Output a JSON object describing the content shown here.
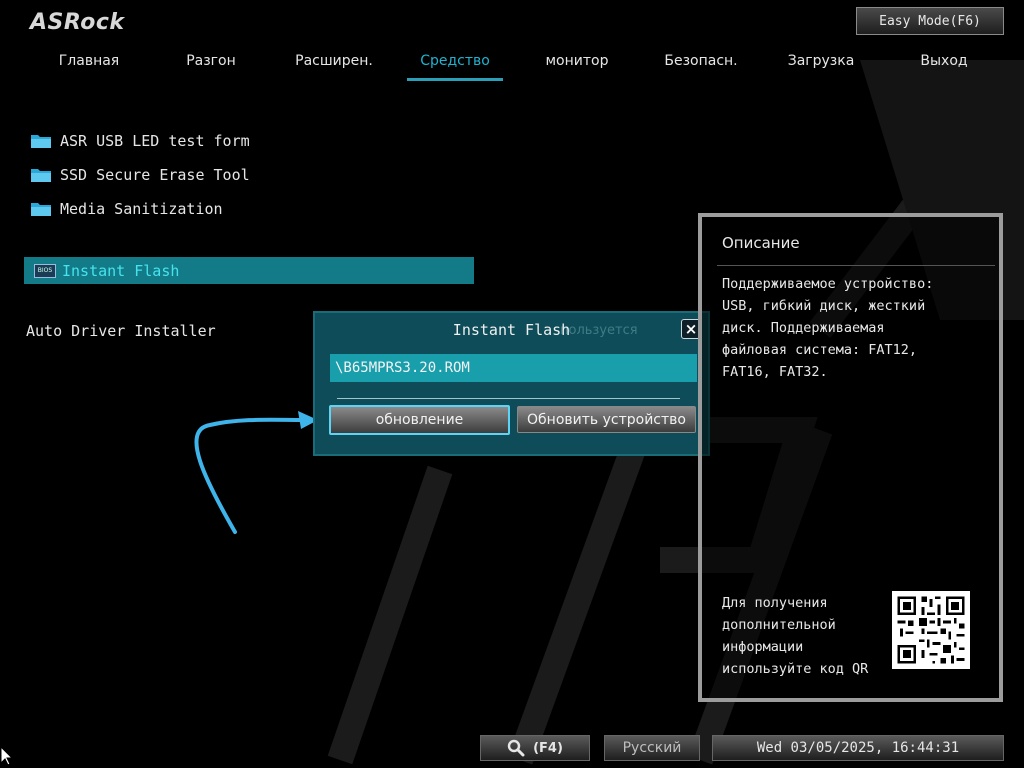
{
  "header": {
    "logo": "ASRock",
    "easy_mode": "Easy Mode(F6)"
  },
  "nav": {
    "tabs": [
      {
        "label": "Главная",
        "active": false
      },
      {
        "label": "Разгон",
        "active": false
      },
      {
        "label": "Расширен.",
        "active": false
      },
      {
        "label": "Средство",
        "active": true
      },
      {
        "label": "монитор",
        "active": false
      },
      {
        "label": "Безопасн.",
        "active": false
      },
      {
        "label": "Загрузка",
        "active": false
      },
      {
        "label": "Выход",
        "active": false
      }
    ]
  },
  "tools": {
    "items": [
      {
        "label": "ASR USB LED test form",
        "icon": "folder-icon"
      },
      {
        "label": "SSD Secure Erase Tool",
        "icon": "folder-icon"
      },
      {
        "label": "Media Sanitization",
        "icon": "folder-icon"
      }
    ],
    "instant_flash": {
      "label": "Instant Flash",
      "icon_text": "BIOS"
    },
    "auto_driver": "Auto Driver Installer"
  },
  "dialog": {
    "title": "Instant Flash",
    "ghost_text": "пользуется",
    "close": "×",
    "file": "\\B65MPRS3.20.ROM",
    "update_button": "обновление",
    "update_device_button": "Обновить устройство"
  },
  "description": {
    "title": "Описание",
    "lines": [
      "Поддерживаемое устройство:",
      "USB, гибкий диск, жесткий",
      "диск. Поддерживаемая",
      "файловая система: FAT12,",
      "FAT16, FAT32."
    ],
    "more_info_lines": [
      "Для получения",
      "дополнительной",
      "информации",
      "используйте код QR"
    ]
  },
  "bottom": {
    "search_label": "(F4)",
    "language": "Русский",
    "datetime": "Wed 03/05/2025, 16:44:31"
  },
  "colors": {
    "accent": "#1fb3d1",
    "selected_row": "#137a88",
    "dialog_bg": "#0d4c58",
    "annotation_arrow": "#3fb4ea"
  }
}
